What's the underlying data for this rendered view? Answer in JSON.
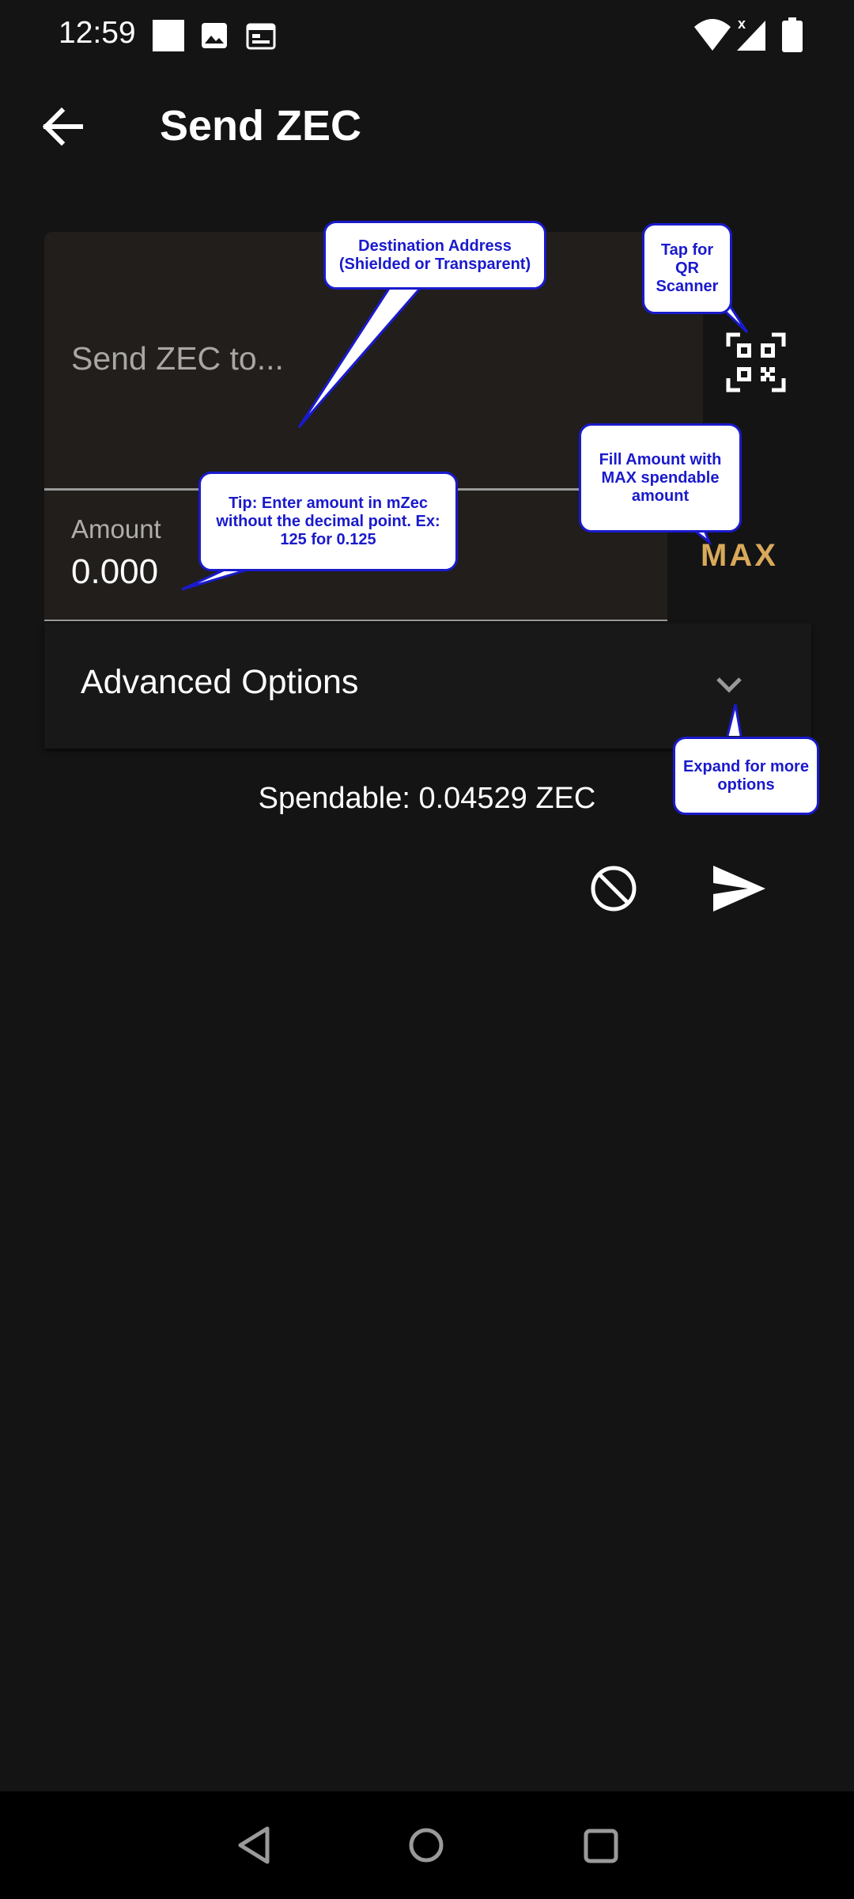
{
  "status_bar": {
    "time": "12:59",
    "icons": [
      "square-icon",
      "image-icon",
      "calendar-icon",
      "wifi-icon",
      "signal-icon",
      "battery-icon"
    ]
  },
  "app_bar": {
    "title": "Send ZEC"
  },
  "form": {
    "address_placeholder": "Send ZEC to...",
    "amount_label": "Amount",
    "amount_value": "0.000",
    "max_label": "MAX",
    "advanced_label": "Advanced Options",
    "spendable": "Spendable: 0.04529 ZEC"
  },
  "tooltips": {
    "destination": "Destination Address (Shielded or Transparent)",
    "qr": "Tap for QR Scanner",
    "amount": "Tip: Enter amount in mZec without the decimal point. Ex: 125 for 0.125",
    "max": "Fill Amount with MAX spendable amount",
    "advanced": "Expand for more options"
  },
  "colors": {
    "background": "#141414",
    "field": "#211e1b",
    "accent": "#d9a95a",
    "tooltip_border": "#1a1acc"
  }
}
